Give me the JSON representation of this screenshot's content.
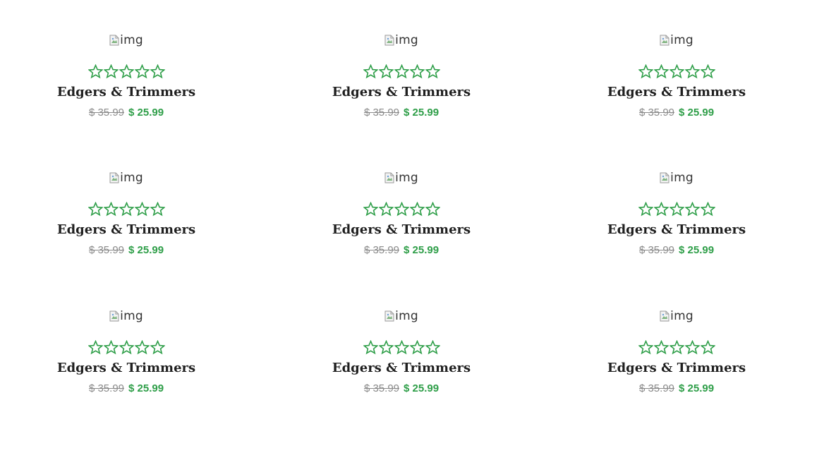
{
  "products": [
    {
      "image_alt": "img",
      "rating": 0,
      "rating_max": 5,
      "title": "Edgers & Trimmers",
      "old_price": "$ 35.99",
      "new_price": "$ 25.99"
    },
    {
      "image_alt": "img",
      "rating": 0,
      "rating_max": 5,
      "title": "Edgers & Trimmers",
      "old_price": "$ 35.99",
      "new_price": "$ 25.99"
    },
    {
      "image_alt": "img",
      "rating": 0,
      "rating_max": 5,
      "title": "Edgers & Trimmers",
      "old_price": "$ 35.99",
      "new_price": "$ 25.99"
    },
    {
      "image_alt": "img",
      "rating": 0,
      "rating_max": 5,
      "title": "Edgers & Trimmers",
      "old_price": "$ 35.99",
      "new_price": "$ 25.99"
    },
    {
      "image_alt": "img",
      "rating": 0,
      "rating_max": 5,
      "title": "Edgers & Trimmers",
      "old_price": "$ 35.99",
      "new_price": "$ 25.99"
    },
    {
      "image_alt": "img",
      "rating": 0,
      "rating_max": 5,
      "title": "Edgers & Trimmers",
      "old_price": "$ 35.99",
      "new_price": "$ 25.99"
    },
    {
      "image_alt": "img",
      "rating": 0,
      "rating_max": 5,
      "title": "Edgers & Trimmers",
      "old_price": "$ 35.99",
      "new_price": "$ 25.99"
    },
    {
      "image_alt": "img",
      "rating": 0,
      "rating_max": 5,
      "title": "Edgers & Trimmers",
      "old_price": "$ 35.99",
      "new_price": "$ 25.99"
    },
    {
      "image_alt": "img",
      "rating": 0,
      "rating_max": 5,
      "title": "Edgers & Trimmers",
      "old_price": "$ 35.99",
      "new_price": "$ 25.99"
    }
  ],
  "colors": {
    "star": "#2e9e48",
    "new_price": "#2e9e48",
    "old_price": "#8a8a8a",
    "title": "#1f1f1f"
  },
  "icons": {
    "star": "star-outline-icon",
    "image": "broken-image-icon"
  }
}
